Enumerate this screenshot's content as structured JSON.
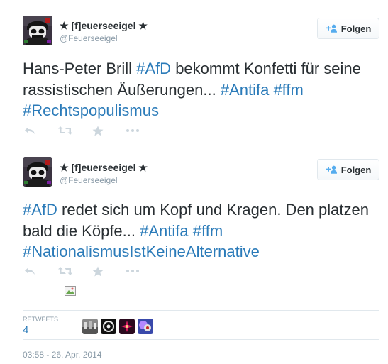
{
  "tweets": [
    {
      "display_name": "[f]euerseeigel",
      "handle": "@Feuerseeigel",
      "follow_label": "Folgen",
      "text_segments": [
        {
          "text": "Hans-Peter Brill ",
          "hashtag": false
        },
        {
          "text": "#AfD",
          "hashtag": true
        },
        {
          "text": " bekommt Konfetti für seine rassistischen Äußerungen... ",
          "hashtag": false
        },
        {
          "text": "#Antifa",
          "hashtag": true
        },
        {
          "text": " ",
          "hashtag": false
        },
        {
          "text": "#ffm",
          "hashtag": true
        },
        {
          "text": " ",
          "hashtag": false
        },
        {
          "text": "#Rechtspopulismus",
          "hashtag": true
        }
      ]
    },
    {
      "display_name": "[f]euerseeigel",
      "handle": "@Feuerseeigel",
      "follow_label": "Folgen",
      "text_segments": [
        {
          "text": "#AfD",
          "hashtag": true
        },
        {
          "text": " redet sich um Kopf und Kragen. Den platzen bald die Köpfe... ",
          "hashtag": false
        },
        {
          "text": "#Antifa",
          "hashtag": true
        },
        {
          "text": " ",
          "hashtag": false
        },
        {
          "text": "#ffm",
          "hashtag": true
        },
        {
          "text": " ",
          "hashtag": false
        },
        {
          "text": "#NationalismusIstKeineAlternative",
          "hashtag": true
        }
      ],
      "stats": {
        "retweets_label": "RETWEETS",
        "retweets_value": "4"
      },
      "timestamp": "03:58 - 26. Apr. 2014"
    }
  ],
  "icons": {
    "star": "★",
    "reply": "reply-icon",
    "retweet": "retweet-icon",
    "favorite": "star-icon",
    "more": "more-icon",
    "follow": "follow-user-icon"
  },
  "colors": {
    "hashtag": "#2b7bb9",
    "meta": "#8899a6",
    "action": "#ccd6dd"
  }
}
